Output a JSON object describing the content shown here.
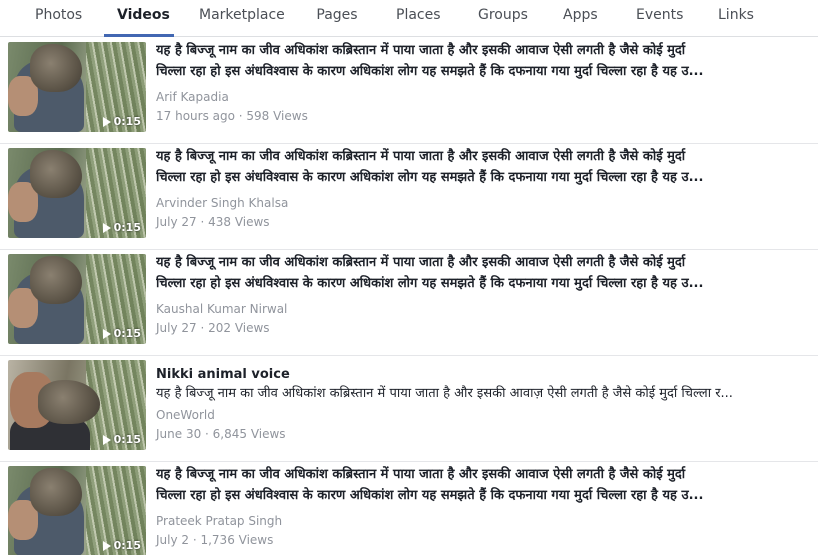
{
  "tabs": [
    {
      "label": "Photos",
      "active": false
    },
    {
      "label": "Videos",
      "active": true
    },
    {
      "label": "Marketplace",
      "active": false
    },
    {
      "label": "Pages",
      "active": false
    },
    {
      "label": "Places",
      "active": false
    },
    {
      "label": "Groups",
      "active": false
    },
    {
      "label": "Apps",
      "active": false
    },
    {
      "label": "Events",
      "active": false
    },
    {
      "label": "Links",
      "active": false
    }
  ],
  "results": [
    {
      "title_line1": "यह है बिज्जू नाम का जीव अधिकांश कब्रिस्तान में पाया जाता है और इसकी आवाज ऐसी लगती है जैसे कोई मुर्दा",
      "title_line2": "चिल्ला रहा हो इस अंधविश्वास के कारण अधिकांश लोग यह समझते हैं कि दफनाया गया मुर्दा चिल्ला रहा है यह उ...",
      "source": "Arif Kapadia",
      "meta": "17 hours ago · 598 Views",
      "duration": "0:15"
    },
    {
      "title_line1": "यह है बिज्जू नाम का जीव अधिकांश कब्रिस्तान में पाया जाता है और इसकी आवाज ऐसी लगती है जैसे कोई मुर्दा",
      "title_line2": "चिल्ला रहा हो इस अंधविश्वास के कारण अधिकांश लोग यह समझते हैं कि दफनाया गया मुर्दा चिल्ला रहा है यह उ...",
      "source": "Arvinder Singh Khalsa",
      "meta": "July 27 · 438 Views",
      "duration": "0:15"
    },
    {
      "title_line1": "यह है बिज्जू नाम का जीव अधिकांश कब्रिस्तान में पाया जाता है और इसकी आवाज ऐसी लगती है जैसे कोई मुर्दा",
      "title_line2": "चिल्ला रहा हो इस अंधविश्वास के कारण अधिकांश लोग यह समझते हैं कि दफनाया गया मुर्दा चिल्ला रहा है यह उ...",
      "source": "Kaushal Kumar Nirwal",
      "meta": "July 27 · 202 Views",
      "duration": "0:15"
    },
    {
      "title_line1": "Nikki animal voice",
      "snippet": "यह है बिज्जू नाम का जीव अधिकांश कब्रिस्तान में पाया जाता है और इसकी आवाज़ ऐसी लगती है जैसे कोई मुर्दा चिल्ला र...",
      "source": "OneWorld",
      "meta": "June 30 · 6,845 Views",
      "duration": "0:15"
    },
    {
      "title_line1": "यह है बिज्जू नाम का जीव अधिकांश कब्रिस्तान में पाया जाता है और इसकी आवाज ऐसी लगती है जैसे कोई मुर्दा",
      "title_line2": "चिल्ला रहा हो इस अंधविश्वास के कारण अधिकांश लोग यह समझते हैं कि दफनाया गया मुर्दा चिल्ला रहा है यह उ...",
      "source": "Prateek Pratap Singh",
      "meta": "July 2 · 1,736 Views",
      "duration": "0:15"
    }
  ]
}
